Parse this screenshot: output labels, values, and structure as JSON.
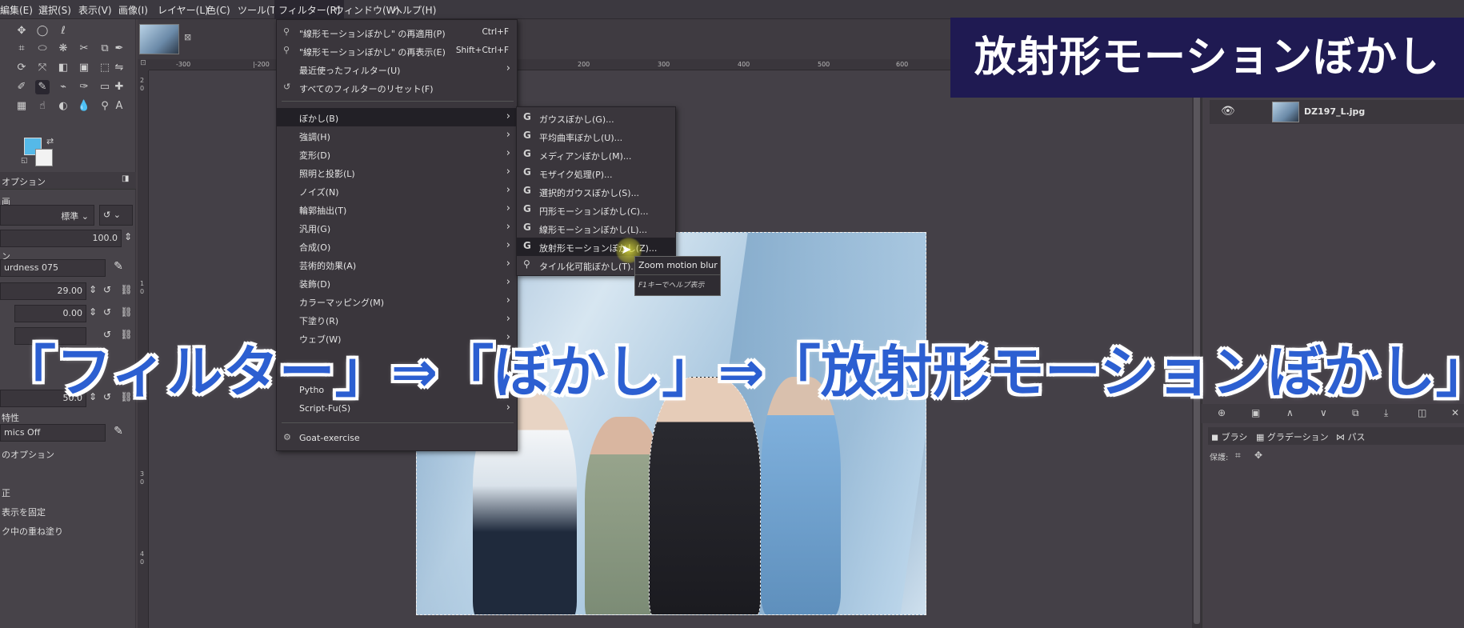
{
  "menubar": {
    "items": [
      "編集(E)",
      "選択(S)",
      "表示(V)",
      "画像(I)",
      "レイヤー(L)",
      "色(C)",
      "ツール(T)",
      "フィルター(R)",
      "ウィンドウ(W)",
      "ヘルプ(H)"
    ]
  },
  "tool_options": {
    "tab_label": "オプション",
    "mode_label": "画",
    "mode_value": "標準",
    "opacity_value": "100.0",
    "brush_label": "ン",
    "brush_value": "urdness 075",
    "size_value": "29.00",
    "aspect_value": "0.00",
    "spacing_value": "50.0",
    "dynamics_label": "特性",
    "dynamics_value": "mics Off",
    "dynamics_options": "のオプション",
    "check1": "正",
    "check2": "表示を固定",
    "check3": "ク中の重ね塗り"
  },
  "rulers": {
    "h_ticks": [
      "-300",
      "|-200",
      "200",
      "300",
      "400",
      "500",
      "600"
    ],
    "v_ticks": [
      "2",
      "0",
      "1",
      "0",
      "3",
      "0",
      "4",
      "0"
    ]
  },
  "filter_menu": {
    "items": [
      {
        "label": "\"線形モーションぼかし\" の再適用(P)",
        "shortcut": "Ctrl+F",
        "icon": "reapply-icon"
      },
      {
        "label": "\"線形モーションぼかし\" の再表示(E)",
        "shortcut": "Shift+Ctrl+F",
        "icon": "reshow-icon"
      },
      {
        "label": "最近使ったフィルター(U)",
        "submenu": true
      },
      {
        "label": "すべてのフィルターのリセット(F)",
        "icon": "reset-icon"
      },
      {
        "label": "ぼかし(B)",
        "submenu": true,
        "highlighted": true
      },
      {
        "label": "強調(H)",
        "submenu": true
      },
      {
        "label": "変形(D)",
        "submenu": true
      },
      {
        "label": "照明と投影(L)",
        "submenu": true
      },
      {
        "label": "ノイズ(N)",
        "submenu": true
      },
      {
        "label": "輪郭抽出(T)",
        "submenu": true
      },
      {
        "label": "汎用(G)",
        "submenu": true
      },
      {
        "label": "合成(O)",
        "submenu": true
      },
      {
        "label": "芸術的効果(A)",
        "submenu": true
      },
      {
        "label": "装飾(D)",
        "submenu": true
      },
      {
        "label": "カラーマッピング(M)",
        "submenu": true
      },
      {
        "label": "下塗り(R)",
        "submenu": true
      },
      {
        "label": "ウェブ(W)",
        "submenu": true
      },
      {
        "label": "Pytho",
        "submenu": false
      },
      {
        "label": "Script-Fu(S)",
        "submenu": true
      },
      {
        "label": "Goat-exercise",
        "icon": "goat-icon"
      }
    ]
  },
  "blur_menu": {
    "items": [
      {
        "label": "ガウスぼかし(G)...",
        "icon": "G"
      },
      {
        "label": "平均曲率ぼかし(U)...",
        "icon": "G"
      },
      {
        "label": "メディアンぼかし(M)...",
        "icon": "G"
      },
      {
        "label": "モザイク処理(P)...",
        "icon": "G"
      },
      {
        "label": "選択的ガウスぼかし(S)...",
        "icon": "G"
      },
      {
        "label": "円形モーションぼかし(C)...",
        "icon": "G"
      },
      {
        "label": "線形モーションぼかし(L)...",
        "icon": "G"
      },
      {
        "label": "放射形モーションぼかし(Z)...",
        "icon": "G",
        "highlighted": true
      },
      {
        "label": "タイル化可能ぼかし(T)...",
        "icon": "plugin"
      }
    ]
  },
  "tooltip": {
    "title": "Zoom motion blur",
    "help": "F1キーでヘルプ表示"
  },
  "layers": {
    "layer_name": "DZ197_L.jpg"
  },
  "dock_tabs": [
    "ブラシ",
    "グラデーション",
    "パス"
  ],
  "dock_lock_label": "保護:",
  "overlay": {
    "title": "放射形モーションぼかし",
    "caption": "「フィルター」⇒「ぼかし」⇒「放射形モーションぼかし」",
    "title_bg": "#1f1a52",
    "caption_color": "#2c5fd1"
  }
}
